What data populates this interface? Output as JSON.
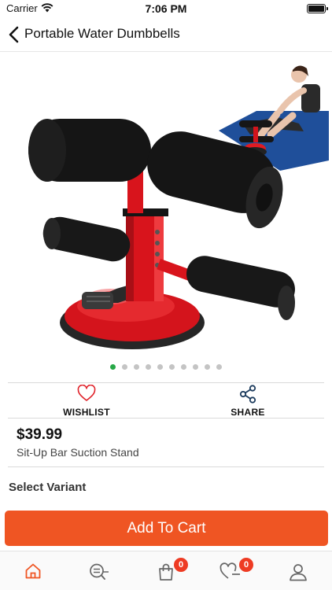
{
  "status_bar": {
    "carrier": "Carrier",
    "time": "7:06 PM"
  },
  "header": {
    "title": "Portable Water Dumbbells",
    "back_icon": "chevron-left-icon"
  },
  "product": {
    "image_alt": "Sit-up bar suction stand",
    "price": "$39.99",
    "name": "Sit-Up Bar Suction Stand",
    "carousel": {
      "total": 10,
      "active_index": 0
    }
  },
  "actions": {
    "wishlist_label": "WISHLIST",
    "share_label": "SHARE"
  },
  "variant": {
    "heading": "Select Variant"
  },
  "add_to_cart_label": "Add To Cart",
  "tab_bar": {
    "cart_badge": "0",
    "wishlist_badge": "0",
    "items": [
      "home-icon",
      "search-list-icon",
      "bag-icon",
      "heart-minus-icon",
      "profile-icon"
    ]
  },
  "colors": {
    "accent": "#ef5523",
    "active_dot": "#27a847",
    "badge": "#ee3b23",
    "wishlist_icon": "#e0222a",
    "share_icon": "#1b3a5c"
  }
}
